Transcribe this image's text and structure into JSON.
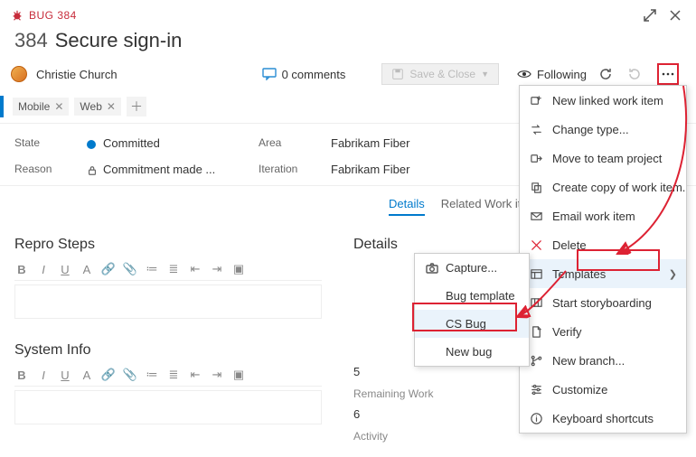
{
  "header": {
    "bug_label": "BUG 384"
  },
  "title": {
    "number": "384",
    "text": "Secure sign-in"
  },
  "assignee": {
    "name": "Christie Church"
  },
  "comments": {
    "label": "0 comments"
  },
  "saveclose": {
    "label": "Save & Close"
  },
  "following": {
    "label": "Following"
  },
  "tags": {
    "items": [
      "Mobile",
      "Web"
    ]
  },
  "fields": {
    "state_label": "State",
    "state_value": "Committed",
    "reason_label": "Reason",
    "reason_value": "Commitment made ...",
    "area_label": "Area",
    "area_value": "Fabrikam Fiber",
    "iteration_label": "Iteration",
    "iteration_value": "Fabrikam Fiber"
  },
  "tabs": {
    "details": "Details",
    "related": "Related Work item"
  },
  "sections": {
    "repro_h": "Repro Steps",
    "sysinfo_h": "System Info",
    "details_h": "Details",
    "effort_value": "5",
    "remaining_label": "Remaining Work",
    "remaining_value": "6",
    "activity_label": "Activity"
  },
  "submenu": {
    "capture": "Capture...",
    "bug_template": "Bug template",
    "cs_bug": "CS Bug",
    "new_bug": "New bug"
  },
  "menu": {
    "new_linked": "New linked work item",
    "change_type": "Change type...",
    "move_team": "Move to team project",
    "create_copy": "Create copy of work item...",
    "email": "Email work item",
    "delete": "Delete",
    "templates": "Templates",
    "storyboarding": "Start storyboarding",
    "verify": "Verify",
    "new_branch": "New branch...",
    "customize": "Customize",
    "shortcuts": "Keyboard shortcuts"
  }
}
